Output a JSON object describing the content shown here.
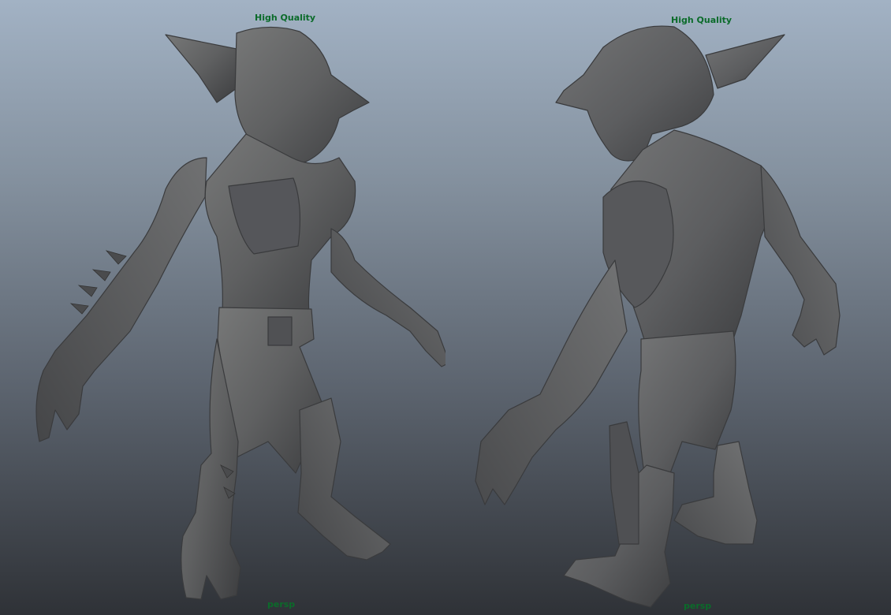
{
  "viewports": [
    {
      "quality_label": "High Quality",
      "camera_label": "persp"
    },
    {
      "quality_label": "High Quality",
      "camera_label": "persp"
    }
  ],
  "colors": {
    "hud_text": "#0b6b2a",
    "background_top": "#a2b2c4",
    "background_bottom": "#2f3237",
    "model_shade": "#5e5f61"
  },
  "subject": "goblin-sculpt"
}
